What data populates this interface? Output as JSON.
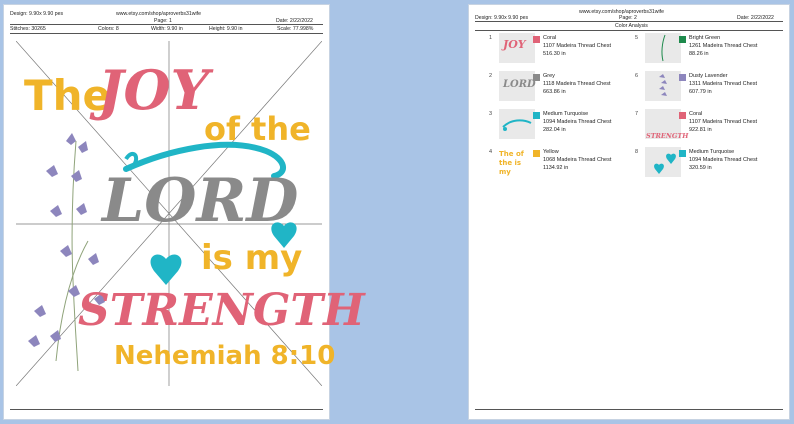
{
  "page1": {
    "header": {
      "design": "Design: 9.90x 9.90 pes",
      "url": "www.etsy.com/shop/aproverbs31wife",
      "page": "Page: 1",
      "date": "Date: 2/22/2022",
      "stitches": "Stitches: 30265",
      "colors": "Colors: 8",
      "width": "Width: 9.90 in",
      "height": "Height: 9.90 in",
      "scale": "Scale: 77.998%"
    },
    "design": {
      "the": "The",
      "joy": "JOY",
      "of_the": "of the",
      "lord": "LORD",
      "is_my": "is my",
      "strength": "STRENGTH",
      "reference": "Nehemiah 8:10"
    }
  },
  "page2": {
    "header": {
      "design": "Design: 9.90x 9.90 pes",
      "url": "www.etsy.com/shop/aproverbs31wife",
      "page": "Page: 2",
      "date": "Date: 2/22/2022",
      "title": "Color Analysis"
    },
    "colors": [
      {
        "num": "1",
        "name": "Coral",
        "thread": "1107 Madeira Thread Chest",
        "length": "516.30 in",
        "hex": "#e06377",
        "thumb": "JOY"
      },
      {
        "num": "2",
        "name": "Grey",
        "thread": "1118 Madeira Thread Chest",
        "length": "663.86 in",
        "hex": "#8a8a8a",
        "thumb": "LORD"
      },
      {
        "num": "3",
        "name": "Medium Turquoise",
        "thread": "1094 Madeira Thread Chest",
        "length": "282.04 in",
        "hex": "#20b5c6",
        "thumb": ""
      },
      {
        "num": "4",
        "name": "Yellow",
        "thread": "1068 Madeira Thread Chest",
        "length": "1134.92 in",
        "hex": "#f0b429",
        "thumb": "The of the is my"
      },
      {
        "num": "5",
        "name": "Bright Green",
        "thread": "1261 Madeira Thread Chest",
        "length": "88.26 in",
        "hex": "#1e8a4c",
        "thumb": ""
      },
      {
        "num": "6",
        "name": "Dusty Lavender",
        "thread": "1311 Madeira Thread Chest",
        "length": "607.79 in",
        "hex": "#8d86bd",
        "thumb": ""
      },
      {
        "num": "7",
        "name": "Coral",
        "thread": "1107 Madeira Thread Chest",
        "length": "922.81 in",
        "hex": "#e06377",
        "thumb": "STRENGTH"
      },
      {
        "num": "8",
        "name": "Medium Turquoise",
        "thread": "1094 Madeira Thread Chest",
        "length": "320.59 in",
        "hex": "#20b5c6",
        "thumb": ""
      }
    ]
  }
}
